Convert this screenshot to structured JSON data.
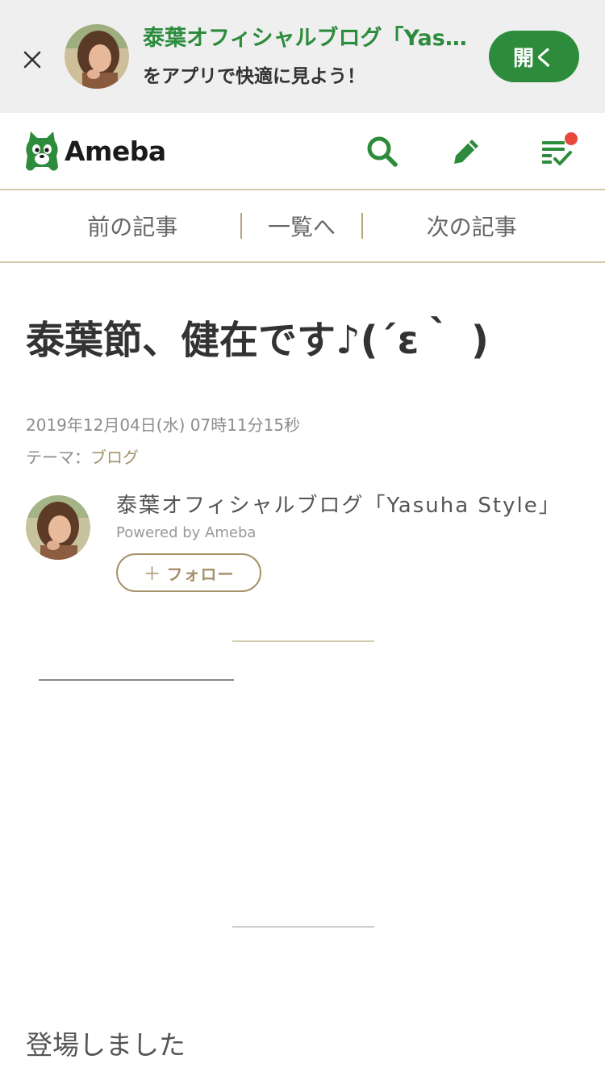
{
  "banner": {
    "title": "泰葉オフィシャルブログ「Yasuha Style」",
    "subtitle": "をアプリで快適に見よう！",
    "open_label": "開く",
    "close_icon": "close-icon"
  },
  "header": {
    "logo_text": "Ameba",
    "icons": [
      "search-icon",
      "pencil-icon",
      "feed-checklist-icon"
    ],
    "accent_color": "#2d8c3c",
    "notification_color": "#e8473b"
  },
  "article_nav": {
    "prev_label": "前の記事",
    "list_label": "一覧へ",
    "next_label": "次の記事"
  },
  "entry": {
    "title": "泰葉節、健在です♪(´ε｀ )",
    "date": "2019年12月04日(水) 07時11分15秒",
    "theme_prefix": "テーマ：",
    "theme": "ブログ",
    "body_first_line": "登場しました"
  },
  "author": {
    "blog_name": "泰葉オフィシャルブログ「Yasuha Style」",
    "powered_by": "Powered by Ameba",
    "follow_plus": "＋",
    "follow_label": "フォロー"
  }
}
